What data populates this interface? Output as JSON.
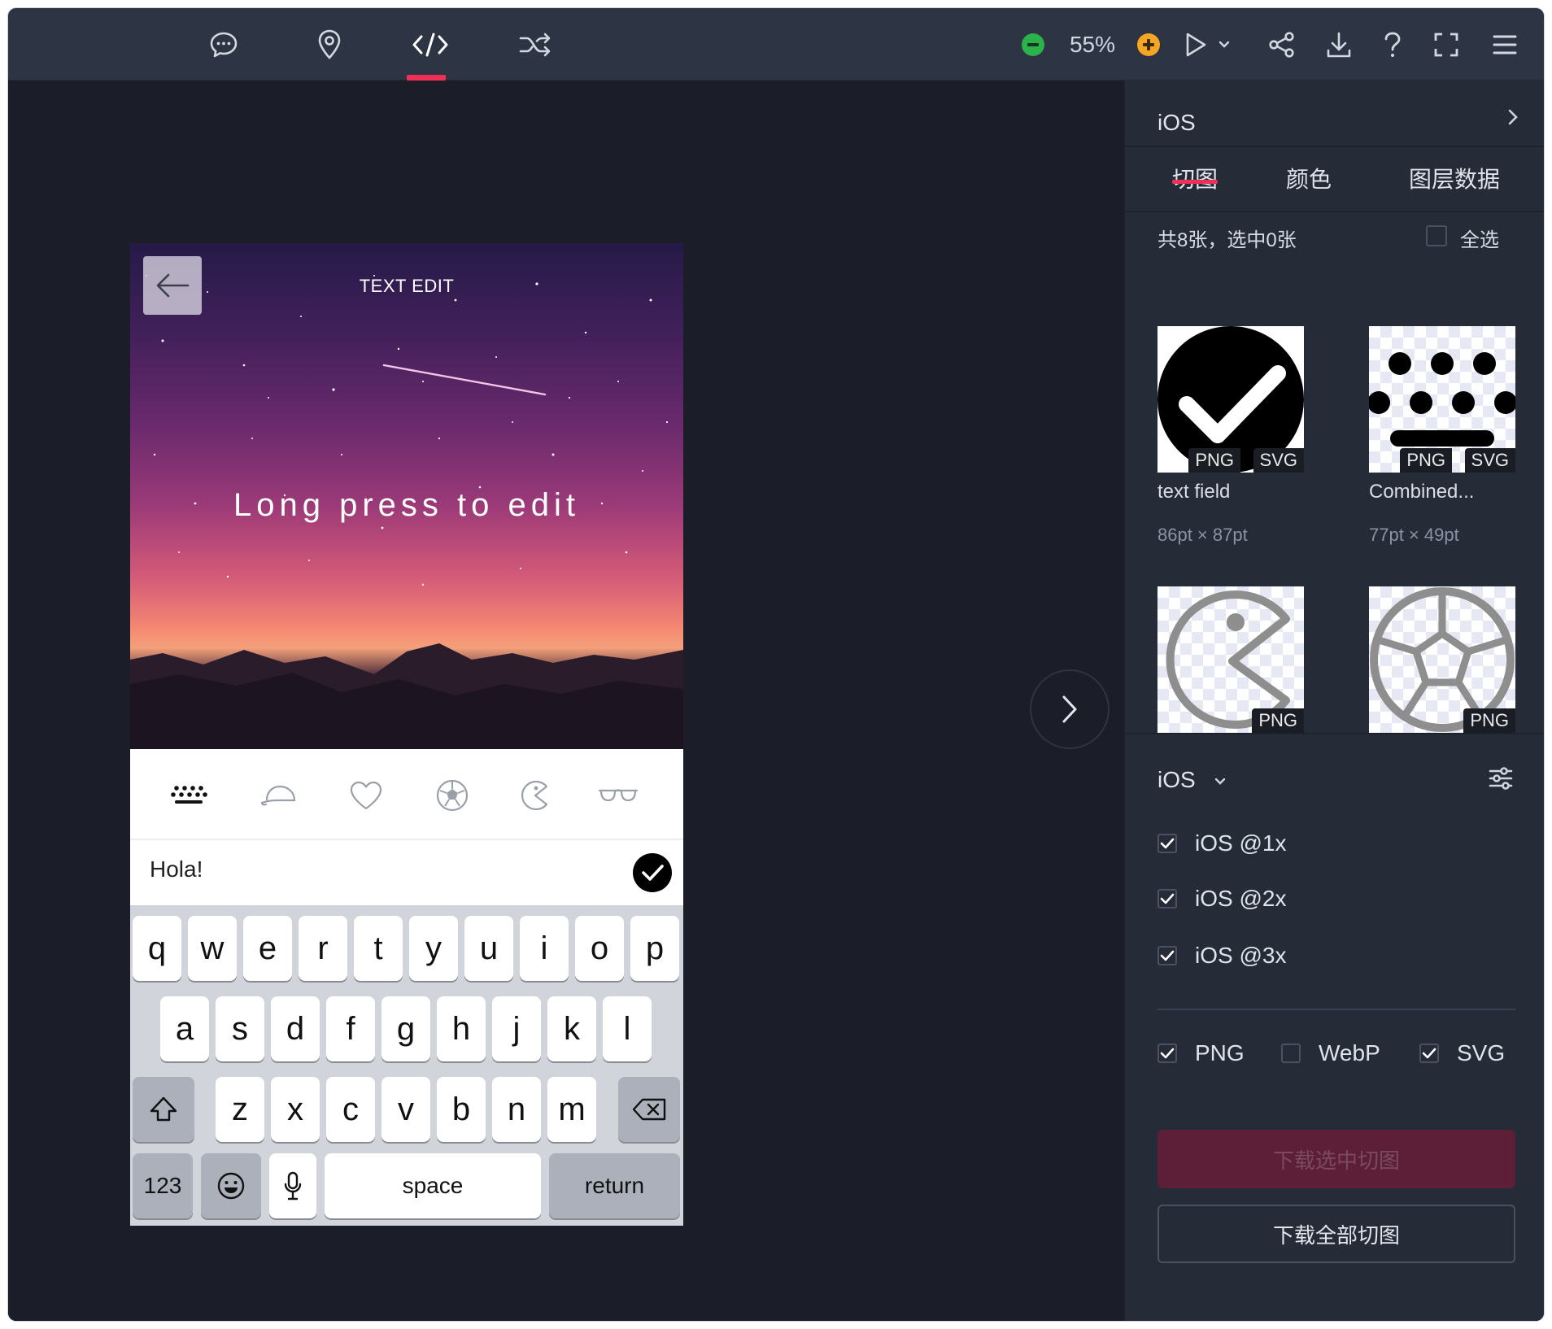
{
  "toolbar": {
    "zoom": "55%"
  },
  "phone": {
    "title": "TEXT EDIT",
    "hint": "Long press to edit",
    "input_value": "Hola!",
    "keyboard": {
      "row1": [
        "q",
        "w",
        "e",
        "r",
        "t",
        "y",
        "u",
        "i",
        "o",
        "p"
      ],
      "row2": [
        "a",
        "s",
        "d",
        "f",
        "g",
        "h",
        "j",
        "k",
        "l"
      ],
      "row3": [
        "z",
        "x",
        "c",
        "v",
        "b",
        "n",
        "m"
      ],
      "num_key": "123",
      "space_key": "space",
      "return_key": "return"
    }
  },
  "panel": {
    "header": "iOS",
    "tabs": [
      "切图",
      "颜色",
      "图层数据"
    ],
    "count_text": "共8张，选中0张",
    "select_all": "全选",
    "assets": [
      {
        "name": "text field",
        "size": "86pt × 87pt",
        "formats": [
          "PNG",
          "SVG"
        ]
      },
      {
        "name": "Combined...",
        "size": "77pt × 49pt",
        "formats": [
          "PNG",
          "SVG"
        ]
      },
      {
        "name": "",
        "size": "",
        "formats": [
          "PNG"
        ]
      },
      {
        "name": "",
        "size": "",
        "formats": [
          "PNG"
        ]
      }
    ],
    "platform": "iOS",
    "scales": [
      {
        "label": "iOS @1x",
        "checked": true
      },
      {
        "label": "iOS @2x",
        "checked": true
      },
      {
        "label": "iOS @3x",
        "checked": true
      }
    ],
    "formats": [
      {
        "label": "PNG",
        "checked": true
      },
      {
        "label": "WebP",
        "checked": false
      },
      {
        "label": "SVG",
        "checked": true
      }
    ],
    "download_selected": "下载选中切图",
    "download_all": "下载全部切图"
  },
  "colors": {
    "accent": "#ef3056",
    "zoom_out": "#2bb24c",
    "zoom_in": "#f5a623"
  }
}
